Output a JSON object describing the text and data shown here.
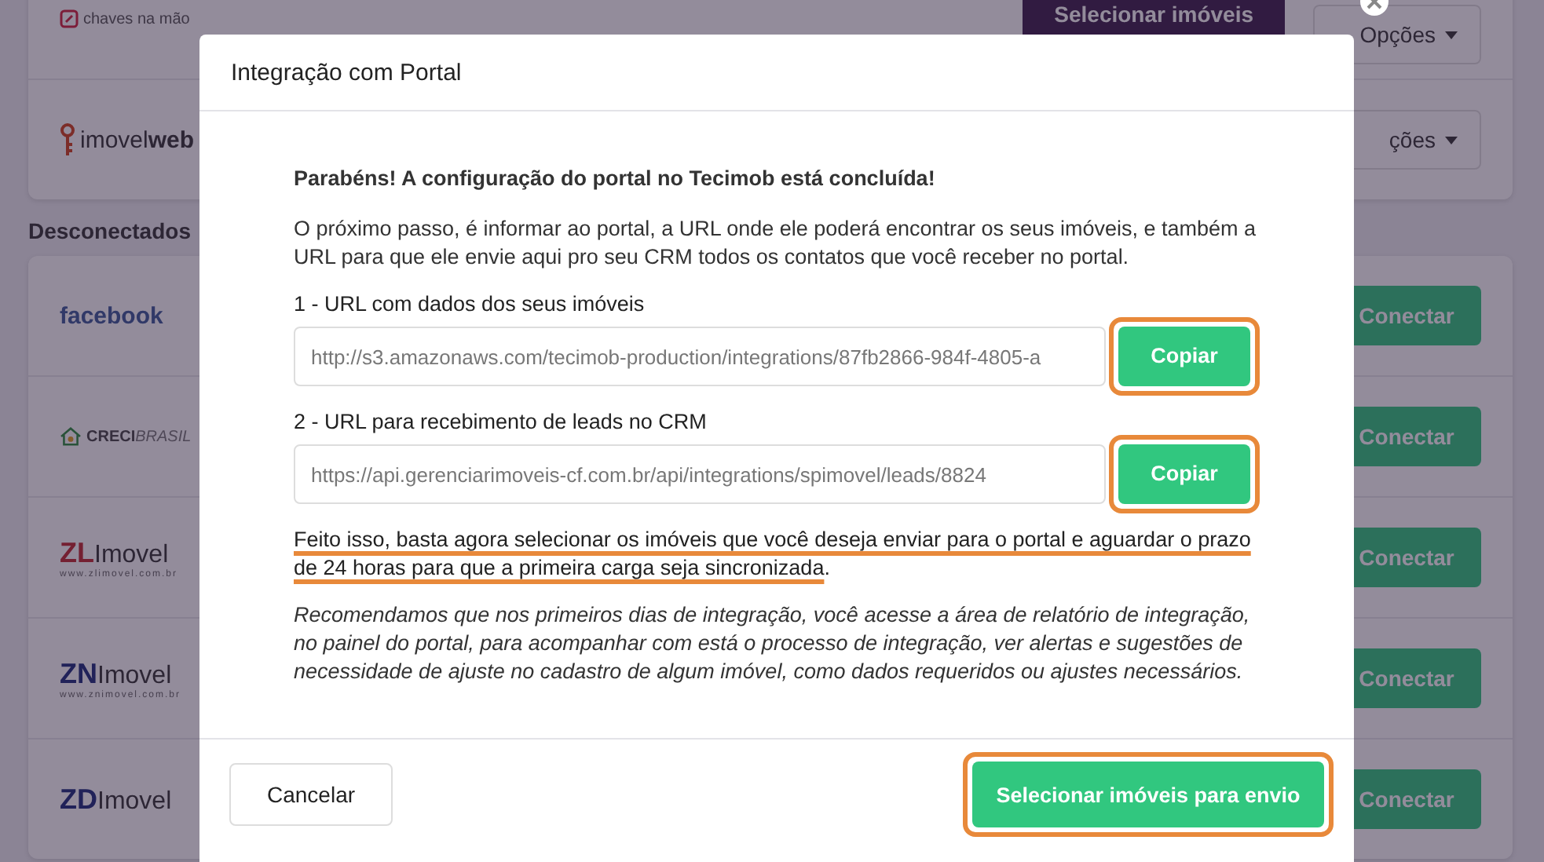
{
  "background_page": {
    "connected": [
      {
        "kind": "chaves",
        "logo": "chaves na mão",
        "select_button": "Selecionar imóveis",
        "options_button": "Opções"
      },
      {
        "kind": "imovelweb",
        "logo": "imovel",
        "logo_rest": "web",
        "options_button": "ções"
      }
    ],
    "disconnected_heading": "Desconectados",
    "disconnected": [
      {
        "kind": "facebook",
        "logo": "facebook",
        "connect_button": "Conectar"
      },
      {
        "kind": "creci",
        "logo": "CRECI",
        "logo_rest": "BRASIL",
        "connect_button": "Conectar"
      },
      {
        "kind": "zl",
        "logo": "ZL",
        "logo_rest": "Imovel",
        "logo_sub": "www.zlimovel.com.br",
        "connect_button": "Conectar"
      },
      {
        "kind": "zn",
        "logo": "ZN",
        "logo_rest": "Imovel",
        "logo_sub": "www.znimovel.com.br",
        "connect_button": "Conectar"
      },
      {
        "kind": "zd",
        "logo": "ZD",
        "logo_rest": "Imovel",
        "connect_button": "Conectar"
      }
    ]
  },
  "modal": {
    "title": "Integração com Portal",
    "success_message": "Parabéns! A configuração do portal no Tecimob está concluída!",
    "intro": "O próximo passo, é informar ao portal, a URL onde ele poderá encontrar os seus imóveis, e também a URL para que ele envie aqui pro seu CRM todos os contatos que você receber no portal.",
    "url_fields": [
      {
        "label": "1 - URL com dados dos seus imóveis",
        "value": "http://s3.amazonaws.com/tecimob-production/integrations/87fb2866-984f-4805-a",
        "button": "Copiar",
        "highlighted": true
      },
      {
        "label": "2 - URL para recebimento de leads no CRM",
        "value": "https://api.gerenciarimoveis-cf.com.br/api/integrations/spimovel/leads/8824",
        "button": "Copiar",
        "highlighted": true
      }
    ],
    "next_step": {
      "underlined": "Feito isso, basta agora selecionar os imóveis que você deseja enviar para o portal e aguardar o prazo de 24 horas para que a primeira carga seja sincronizada",
      "rest": "."
    },
    "recommendation": "Recomendamos que nos primeiros dias de integração, você acesse a área de relatório de integração, no painel do portal, para acompanhar com está o processo de integração, ver alertas e sugestões de necessidade de ajuste no cadastro de algum imóvel, como dados requeridos ou ajustes necessários.",
    "cancel_button": "Cancelar",
    "confirm_button": {
      "label": "Selecionar imóveis para envio",
      "highlighted": true
    }
  }
}
